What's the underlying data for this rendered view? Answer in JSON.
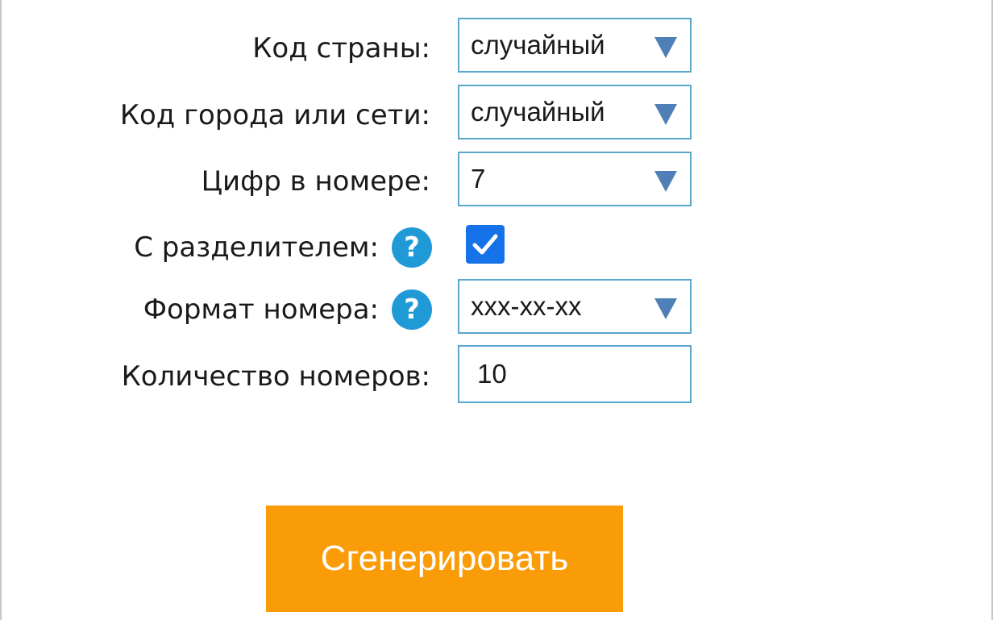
{
  "form": {
    "country_code": {
      "label": "Код страны:",
      "value": "случайный"
    },
    "city_code": {
      "label": "Код города или сети:",
      "value": "случайный"
    },
    "digits": {
      "label": "Цифр в номере:",
      "value": "7"
    },
    "separator": {
      "label": "С разделителем:",
      "checked": true,
      "help_icon": "question-circle-icon"
    },
    "format": {
      "label": "Формат номера:",
      "value": "xxx-xx-xx",
      "help_icon": "question-circle-icon"
    },
    "quantity": {
      "label": "Количество номеров:",
      "value": "10"
    }
  },
  "actions": {
    "generate_label": "Сгенерировать"
  },
  "colors": {
    "accent_button": "#fa9c08",
    "input_border": "#5aa6cf",
    "dropdown_arrow": "#4f7fb7",
    "help_icon": "#1f9ad6",
    "checkbox": "#1672e8"
  }
}
